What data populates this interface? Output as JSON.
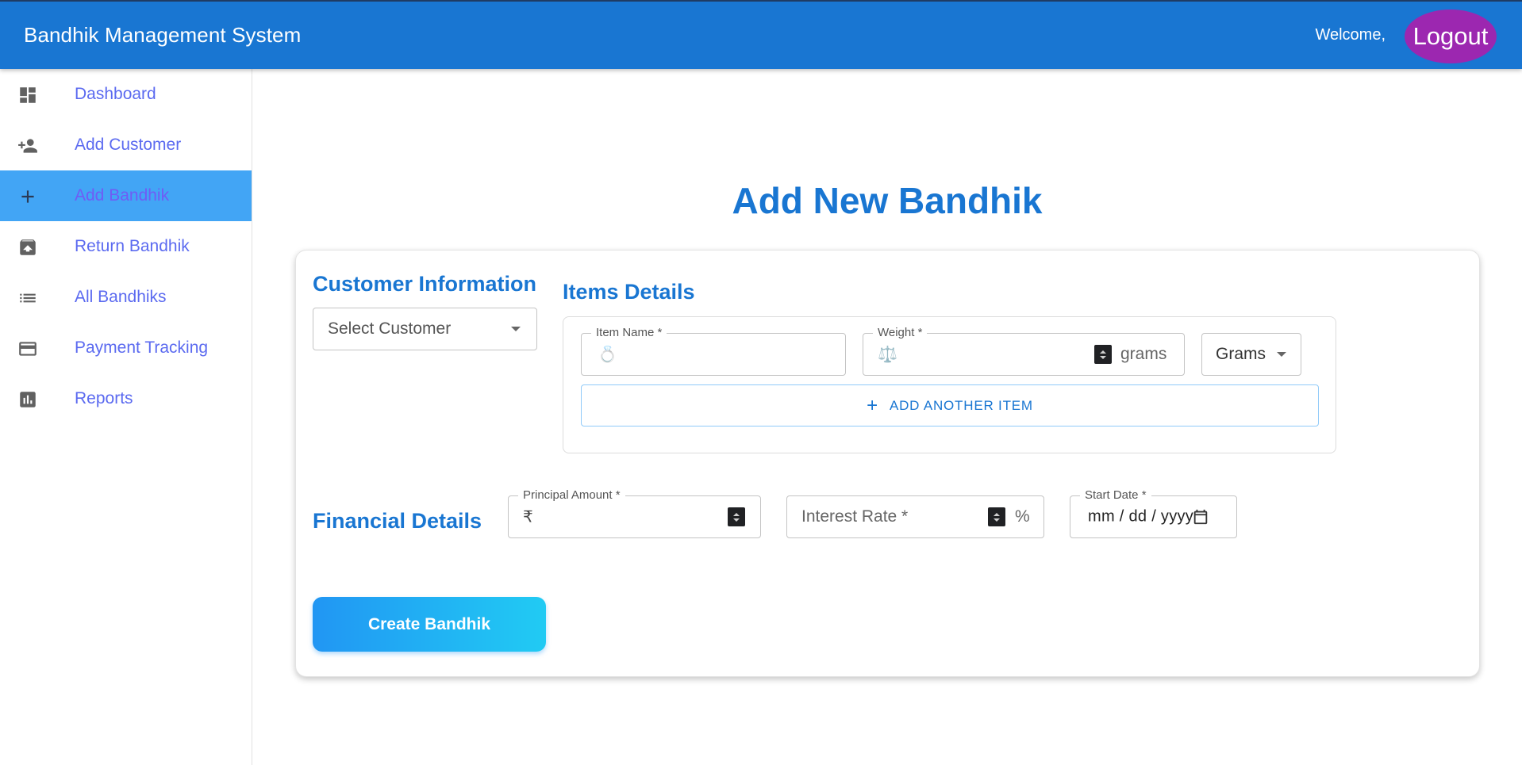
{
  "header": {
    "title": "Bandhik Management System",
    "welcome": "Welcome,",
    "logout_label": "Logout",
    "bar_color": "#1976d2",
    "logout_color": "#9c27b0"
  },
  "sidebar": {
    "items": [
      {
        "label": "Dashboard",
        "icon": "dashboard-icon"
      },
      {
        "label": "Add Customer",
        "icon": "person-add-icon"
      },
      {
        "label": "Add Bandhik",
        "icon": "plus-icon",
        "active": true
      },
      {
        "label": "Return Bandhik",
        "icon": "archive-icon"
      },
      {
        "label": "All Bandhiks",
        "icon": "list-icon"
      },
      {
        "label": "Payment Tracking",
        "icon": "credit-card-icon"
      },
      {
        "label": "Reports",
        "icon": "bar-chart-icon"
      }
    ]
  },
  "main": {
    "page_title": "Add New Bandhik",
    "customer": {
      "section_title": "Customer Information",
      "select_placeholder": "Select Customer"
    },
    "items": {
      "section_title": "Items Details",
      "item_name_label": "Item Name *",
      "item_name_icon": "💍",
      "weight_label": "Weight *",
      "weight_icon": "⚖️",
      "weight_suffix": "grams",
      "unit_selected": "Grams",
      "add_item_label": "ADD ANOTHER ITEM"
    },
    "financial": {
      "section_title": "Financial Details",
      "principal_label": "Principal Amount *",
      "currency_symbol": "₹",
      "interest_placeholder": "Interest Rate *",
      "interest_suffix": "%",
      "start_date_label": "Start Date *",
      "start_date_placeholder": "mm / dd / yyyy"
    },
    "create_button_label": "Create Bandhik"
  }
}
